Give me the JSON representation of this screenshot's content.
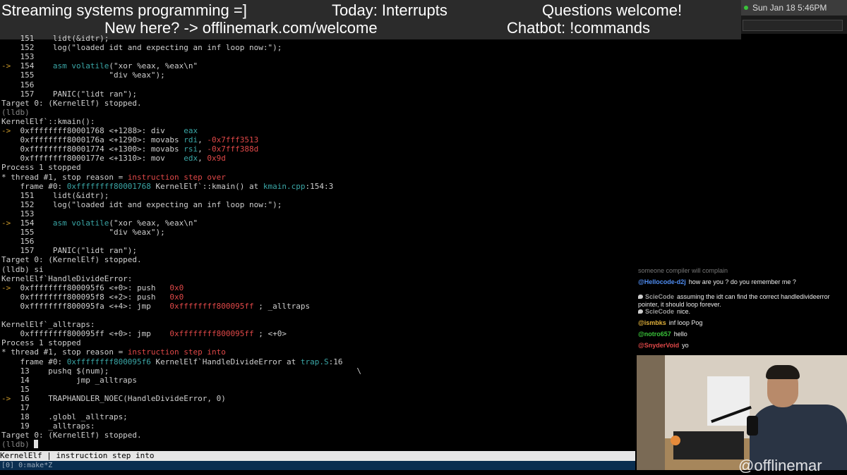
{
  "banner": {
    "title": "Streaming systems programming =]",
    "topic": "Today: Interrupts",
    "questions": "Questions welcome!",
    "welcome": "New here? -> offlinemark.com/welcome",
    "chatbot": "Chatbot: !commands"
  },
  "menubar": {
    "datetime": "Sun Jan 18  5:46PM"
  },
  "terminal": {
    "lines": [
      {
        "segs": [
          {
            "t": "    151    lidt(&idtr);"
          }
        ]
      },
      {
        "segs": [
          {
            "t": "    152    log(\"loaded idt and expecting an inf loop now:\");"
          }
        ]
      },
      {
        "segs": [
          {
            "t": "    153"
          }
        ]
      },
      {
        "segs": [
          {
            "t": "-> ",
            "c": "arrow"
          },
          {
            "t": " 154    "
          },
          {
            "t": "asm",
            "c": "c-kw"
          },
          {
            "t": " "
          },
          {
            "t": "volatile",
            "c": "c-kw"
          },
          {
            "t": "(\"xor %eax, %eax\\n\""
          }
        ]
      },
      {
        "segs": [
          {
            "t": "    155                \"div %eax\");"
          }
        ]
      },
      {
        "segs": [
          {
            "t": "    156"
          }
        ]
      },
      {
        "segs": [
          {
            "t": "    157    PANIC(\"lidt ran\");"
          }
        ]
      },
      {
        "segs": [
          {
            "t": "Target 0: (KernelElf) stopped."
          }
        ]
      },
      {
        "segs": [
          {
            "t": "(lldb)",
            "c": "c-dim"
          }
        ]
      },
      {
        "segs": [
          {
            "t": "KernelElf`::kmain():"
          }
        ]
      },
      {
        "segs": [
          {
            "t": "->  ",
            "c": "arrow"
          },
          {
            "t": "0xffffffff80001768 <+1288>: div    "
          },
          {
            "t": "eax",
            "c": "c-teal"
          }
        ]
      },
      {
        "segs": [
          {
            "t": "    0xffffffff8000176a <+1290>: movabs "
          },
          {
            "t": "rdi",
            "c": "c-teal"
          },
          {
            "t": ", "
          },
          {
            "t": "-0x7fff3513",
            "c": "c-red"
          }
        ]
      },
      {
        "segs": [
          {
            "t": "    0xffffffff80001774 <+1300>: movabs "
          },
          {
            "t": "rsi",
            "c": "c-teal"
          },
          {
            "t": ", "
          },
          {
            "t": "-0x7fff388d",
            "c": "c-red"
          }
        ]
      },
      {
        "segs": [
          {
            "t": "    0xffffffff8000177e <+1310>: mov    "
          },
          {
            "t": "edx",
            "c": "c-teal"
          },
          {
            "t": ", "
          },
          {
            "t": "0x9d",
            "c": "c-red"
          }
        ]
      },
      {
        "segs": [
          {
            "t": "Process 1 stopped"
          }
        ]
      },
      {
        "segs": [
          {
            "t": "* thread #1, stop reason = "
          },
          {
            "t": "instruction step over",
            "c": "c-red"
          }
        ]
      },
      {
        "segs": [
          {
            "t": "    frame #0: "
          },
          {
            "t": "0xffffffff80001768",
            "c": "c-teal"
          },
          {
            "t": " KernelElf`::kmain() at "
          },
          {
            "t": "kmain.cpp",
            "c": "c-teal"
          },
          {
            "t": ":154:3"
          }
        ]
      },
      {
        "segs": [
          {
            "t": "    151    lidt(&idtr);"
          }
        ]
      },
      {
        "segs": [
          {
            "t": "    152    log(\"loaded idt and expecting an inf loop now:\");"
          }
        ]
      },
      {
        "segs": [
          {
            "t": "    153"
          }
        ]
      },
      {
        "segs": [
          {
            "t": "-> ",
            "c": "arrow"
          },
          {
            "t": " 154    "
          },
          {
            "t": "asm",
            "c": "c-kw"
          },
          {
            "t": " "
          },
          {
            "t": "volatile",
            "c": "c-kw"
          },
          {
            "t": "(\"xor %eax, %eax\\n\""
          }
        ]
      },
      {
        "segs": [
          {
            "t": "    155                \"div %eax\");"
          }
        ]
      },
      {
        "segs": [
          {
            "t": "    156"
          }
        ]
      },
      {
        "segs": [
          {
            "t": "    157    PANIC(\"lidt ran\");"
          }
        ]
      },
      {
        "segs": [
          {
            "t": "Target 0: (KernelElf) stopped."
          }
        ]
      },
      {
        "segs": [
          {
            "t": "(lldb) si"
          }
        ]
      },
      {
        "segs": [
          {
            "t": "KernelElf`HandleDivideError:"
          }
        ]
      },
      {
        "segs": [
          {
            "t": "->  ",
            "c": "arrow"
          },
          {
            "t": "0xffffffff800095f6 <+0>: push   "
          },
          {
            "t": "0x0",
            "c": "c-red"
          }
        ]
      },
      {
        "segs": [
          {
            "t": "    0xffffffff800095f8 <+2>: push   "
          },
          {
            "t": "0x0",
            "c": "c-red"
          }
        ]
      },
      {
        "segs": [
          {
            "t": "    0xffffffff800095fa <+4>: jmp    "
          },
          {
            "t": "0xffffffff800095ff",
            "c": "c-red"
          },
          {
            "t": " ; _alltraps"
          }
        ]
      },
      {
        "segs": [
          {
            "t": ""
          }
        ]
      },
      {
        "segs": [
          {
            "t": "KernelElf`_alltraps:"
          }
        ]
      },
      {
        "segs": [
          {
            "t": "    0xffffffff800095ff <+0>: jmp    "
          },
          {
            "t": "0xffffffff800095ff",
            "c": "c-red"
          },
          {
            "t": " ; <+0>"
          }
        ]
      },
      {
        "segs": [
          {
            "t": "Process 1 stopped"
          }
        ]
      },
      {
        "segs": [
          {
            "t": "* thread #1, stop reason = "
          },
          {
            "t": "instruction step into",
            "c": "c-red"
          }
        ]
      },
      {
        "segs": [
          {
            "t": "    frame #0: "
          },
          {
            "t": "0xffffffff800095f6",
            "c": "c-teal"
          },
          {
            "t": " KernelElf`HandleDivideError at "
          },
          {
            "t": "trap.S",
            "c": "c-teal"
          },
          {
            "t": ":16"
          }
        ]
      },
      {
        "segs": [
          {
            "t": "    13    pushq $(num);                                                     \\"
          }
        ]
      },
      {
        "segs": [
          {
            "t": "    14          jmp _alltraps"
          }
        ]
      },
      {
        "segs": [
          {
            "t": "    15"
          }
        ]
      },
      {
        "segs": [
          {
            "t": "-> ",
            "c": "arrow"
          },
          {
            "t": " 16    TRAPHANDLER_NOEC(HandleDivideError, 0)"
          }
        ]
      },
      {
        "segs": [
          {
            "t": "    17"
          }
        ]
      },
      {
        "segs": [
          {
            "t": "    18    .globl _alltraps;"
          }
        ]
      },
      {
        "segs": [
          {
            "t": "    19    _alltraps:"
          }
        ]
      },
      {
        "segs": [
          {
            "t": "Target 0: (KernelElf) stopped."
          }
        ]
      },
      {
        "segs": [
          {
            "t": "(lldb) ",
            "c": "c-dim"
          }
        ],
        "cursor": true
      }
    ]
  },
  "statusbar": {
    "text": "KernelElf | instruction step into"
  },
  "tmux": {
    "text": "[0] 0:make*Z"
  },
  "chat": {
    "partial": "someone compiler will complain",
    "messages": [
      {
        "user": "@Hellocode-d2j",
        "color": "#4f8df2",
        "text": "how are you ? do you remember me ?",
        "icon": false
      },
      {
        "user": "ScieCode",
        "color": "#9a9a9a",
        "text": "assuming the idt can find the correct handledivideerror pointer, it should loop forever.",
        "icon": true
      },
      {
        "user": "ScieCode",
        "color": "#9a9a9a",
        "text": "nice.",
        "icon": true
      },
      {
        "user": "@ismbks",
        "color": "#e0b03a",
        "text": "inf loop Pog",
        "icon": false
      },
      {
        "user": "@notro657",
        "color": "#3ac43a",
        "text": "hello",
        "icon": false
      },
      {
        "user": "@SnyderVoid",
        "color": "#e04848",
        "text": "yo",
        "icon": false
      }
    ]
  },
  "watermark": "@offlinemar"
}
